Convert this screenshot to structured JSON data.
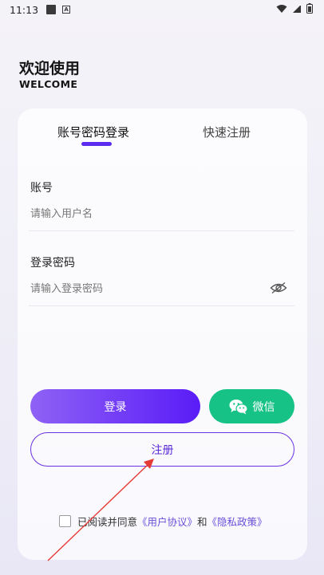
{
  "status_bar": {
    "time": "11:13",
    "a_label": "A"
  },
  "header": {
    "title_cn": "欢迎使用",
    "title_en": "WELCOME"
  },
  "tabs": {
    "login": "账号密码登录",
    "register": "快速注册"
  },
  "form": {
    "account_label": "账号",
    "account_placeholder": "请输入用户名",
    "password_label": "登录密码",
    "password_placeholder": "请输入登录密码"
  },
  "buttons": {
    "login": "登录",
    "wechat": "微信",
    "register": "注册"
  },
  "agreement": {
    "prefix": "已阅读并同意",
    "user_agreement": "《用户协议》",
    "and": "和",
    "privacy_policy": "《隐私政策》"
  },
  "colors": {
    "accent": "#5b2bf1",
    "wechat": "#17c287",
    "annotation": "#e53935"
  }
}
